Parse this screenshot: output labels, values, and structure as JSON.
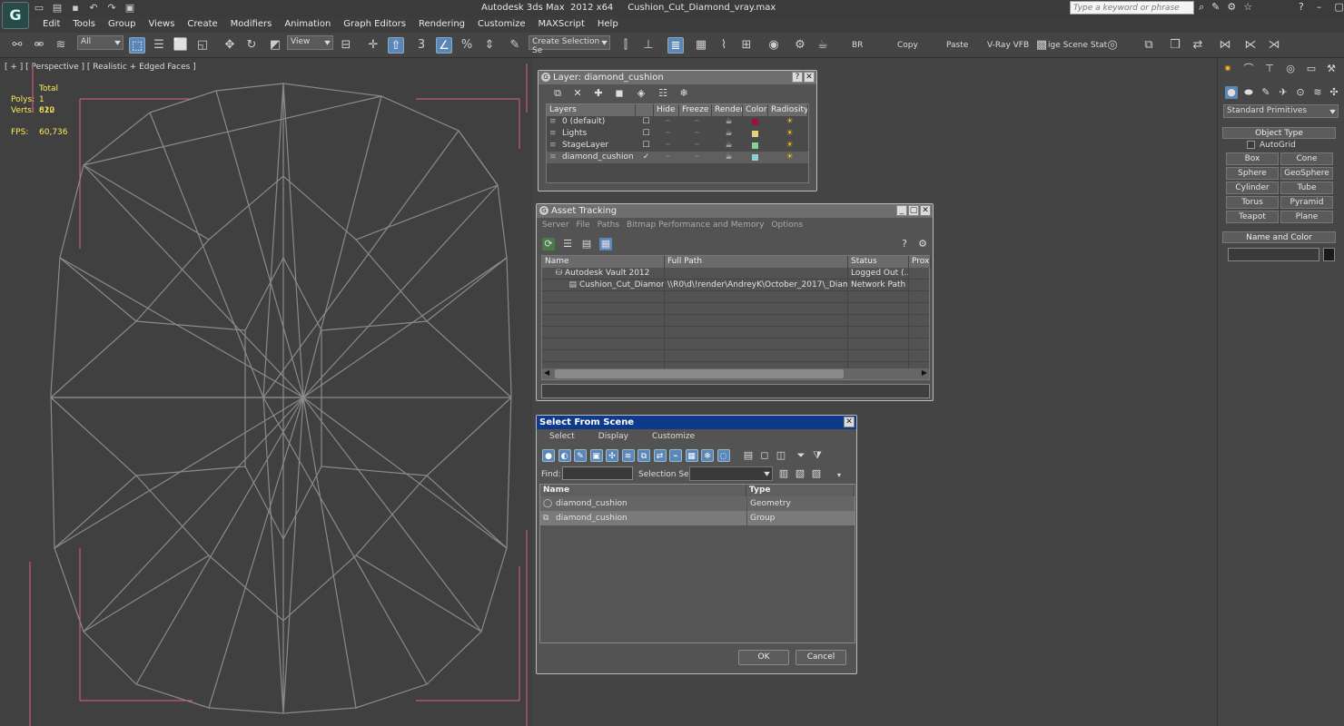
{
  "app": {
    "logo": "G",
    "title": "Autodesk 3ds Max  2012 x64     Cushion_Cut_Diamond_vray.max",
    "search_placeholder": "Type a keyword or phrase"
  },
  "menu": [
    "Edit",
    "Tools",
    "Group",
    "Views",
    "Create",
    "Modifiers",
    "Animation",
    "Graph Editors",
    "Rendering",
    "Customize",
    "MAXScript",
    "Help"
  ],
  "toolbar": {
    "filter": "All",
    "coord": "View",
    "snap_label": "3",
    "selection_set": "Create Selection Se",
    "br": "BR",
    "copy": "Copy",
    "paste": "Paste",
    "vfb": "V-Ray VFB",
    "scene_states": "ige Scene Stat"
  },
  "viewport": {
    "label": "[ + ] [ Perspective ] [ Realistic + Edged Faces ]",
    "stats_total": "Total",
    "polys_label": "Polys:",
    "polys": "1 620",
    "verts_label": "Verts:",
    "verts": "812",
    "fps_label": "FPS:",
    "fps": "60,736"
  },
  "layer_dialog": {
    "title": "Layer: diamond_cushion",
    "columns": [
      "Layers",
      "Hide",
      "Freeze",
      "Render",
      "Color",
      "Radiosity"
    ],
    "rows": [
      {
        "name": "0 (default)",
        "color": "#a0103a"
      },
      {
        "name": "Lights",
        "color": "#e8d078"
      },
      {
        "name": "StageLayer",
        "color": "#88d09a"
      },
      {
        "name": "diamond_cushion",
        "color": "#8cd0d8"
      }
    ]
  },
  "asset_dialog": {
    "title": "Asset Tracking",
    "menu": [
      "Server",
      "File",
      "Paths",
      "Bitmap Performance and Memory",
      "Options"
    ],
    "columns": [
      "Name",
      "Full Path",
      "Status",
      "Proxy"
    ],
    "rows": [
      {
        "name": "Autodesk Vault 2012",
        "path": "",
        "status": "Logged Out (..."
      },
      {
        "name": "Cushion_Cut_Diamon...",
        "path": "\\\\R0\\d\\!render\\AndreyK\\October_2017\\_Diamon...",
        "status": "Network Path"
      }
    ]
  },
  "select_dialog": {
    "title": "Select From Scene",
    "menu": [
      "Select",
      "Display",
      "Customize"
    ],
    "find_label": "Find:",
    "selset_label": "Selection Set:",
    "columns": [
      "Name",
      "Type"
    ],
    "rows": [
      {
        "name": "diamond_cushion",
        "type": "Geometry"
      },
      {
        "name": "diamond_cushion",
        "type": "Group"
      }
    ],
    "ok": "OK",
    "cancel": "Cancel"
  },
  "command_panel": {
    "dropdown": "Standard Primitives",
    "object_type": "Object Type",
    "autogrid": "AutoGrid",
    "buttons": [
      "Box",
      "Cone",
      "Sphere",
      "GeoSphere",
      "Cylinder",
      "Tube",
      "Torus",
      "Pyramid",
      "Teapot",
      "Plane"
    ],
    "name_color": "Name and Color",
    "object_color": "#1a1a1a"
  }
}
